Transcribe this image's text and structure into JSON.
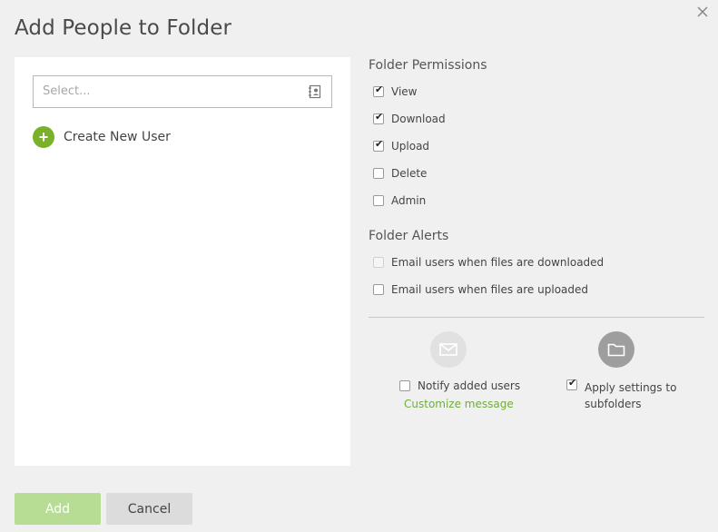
{
  "dialog": {
    "title": "Add People to Folder",
    "close_icon": "close-icon"
  },
  "left": {
    "select_placeholder": "Select...",
    "address_book_icon": "address-book-icon",
    "create_user_label": "Create New User",
    "create_user_icon": "plus-circle-icon"
  },
  "permissions": {
    "title": "Folder Permissions",
    "items": [
      {
        "label": "View",
        "checked": true
      },
      {
        "label": "Download",
        "checked": true
      },
      {
        "label": "Upload",
        "checked": true
      },
      {
        "label": "Delete",
        "checked": false
      },
      {
        "label": "Admin",
        "checked": false
      }
    ]
  },
  "alerts": {
    "title": "Folder Alerts",
    "items": [
      {
        "label": "Email users when files are downloaded",
        "checked": false,
        "disabled": true
      },
      {
        "label": "Email users when files are uploaded",
        "checked": false,
        "disabled": false
      }
    ]
  },
  "options": {
    "notify_label": "Notify added users",
    "notify_checked": false,
    "customize_link": "Customize message",
    "apply_label": "Apply settings to subfolders",
    "apply_checked": true,
    "mail_icon": "mail-icon",
    "folder_icon": "folder-icon"
  },
  "buttons": {
    "add": "Add",
    "cancel": "Cancel"
  },
  "colors": {
    "accent_green": "#7ab12b",
    "add_button_disabled": "#b7dd95",
    "link_green": "#6fae3c"
  }
}
